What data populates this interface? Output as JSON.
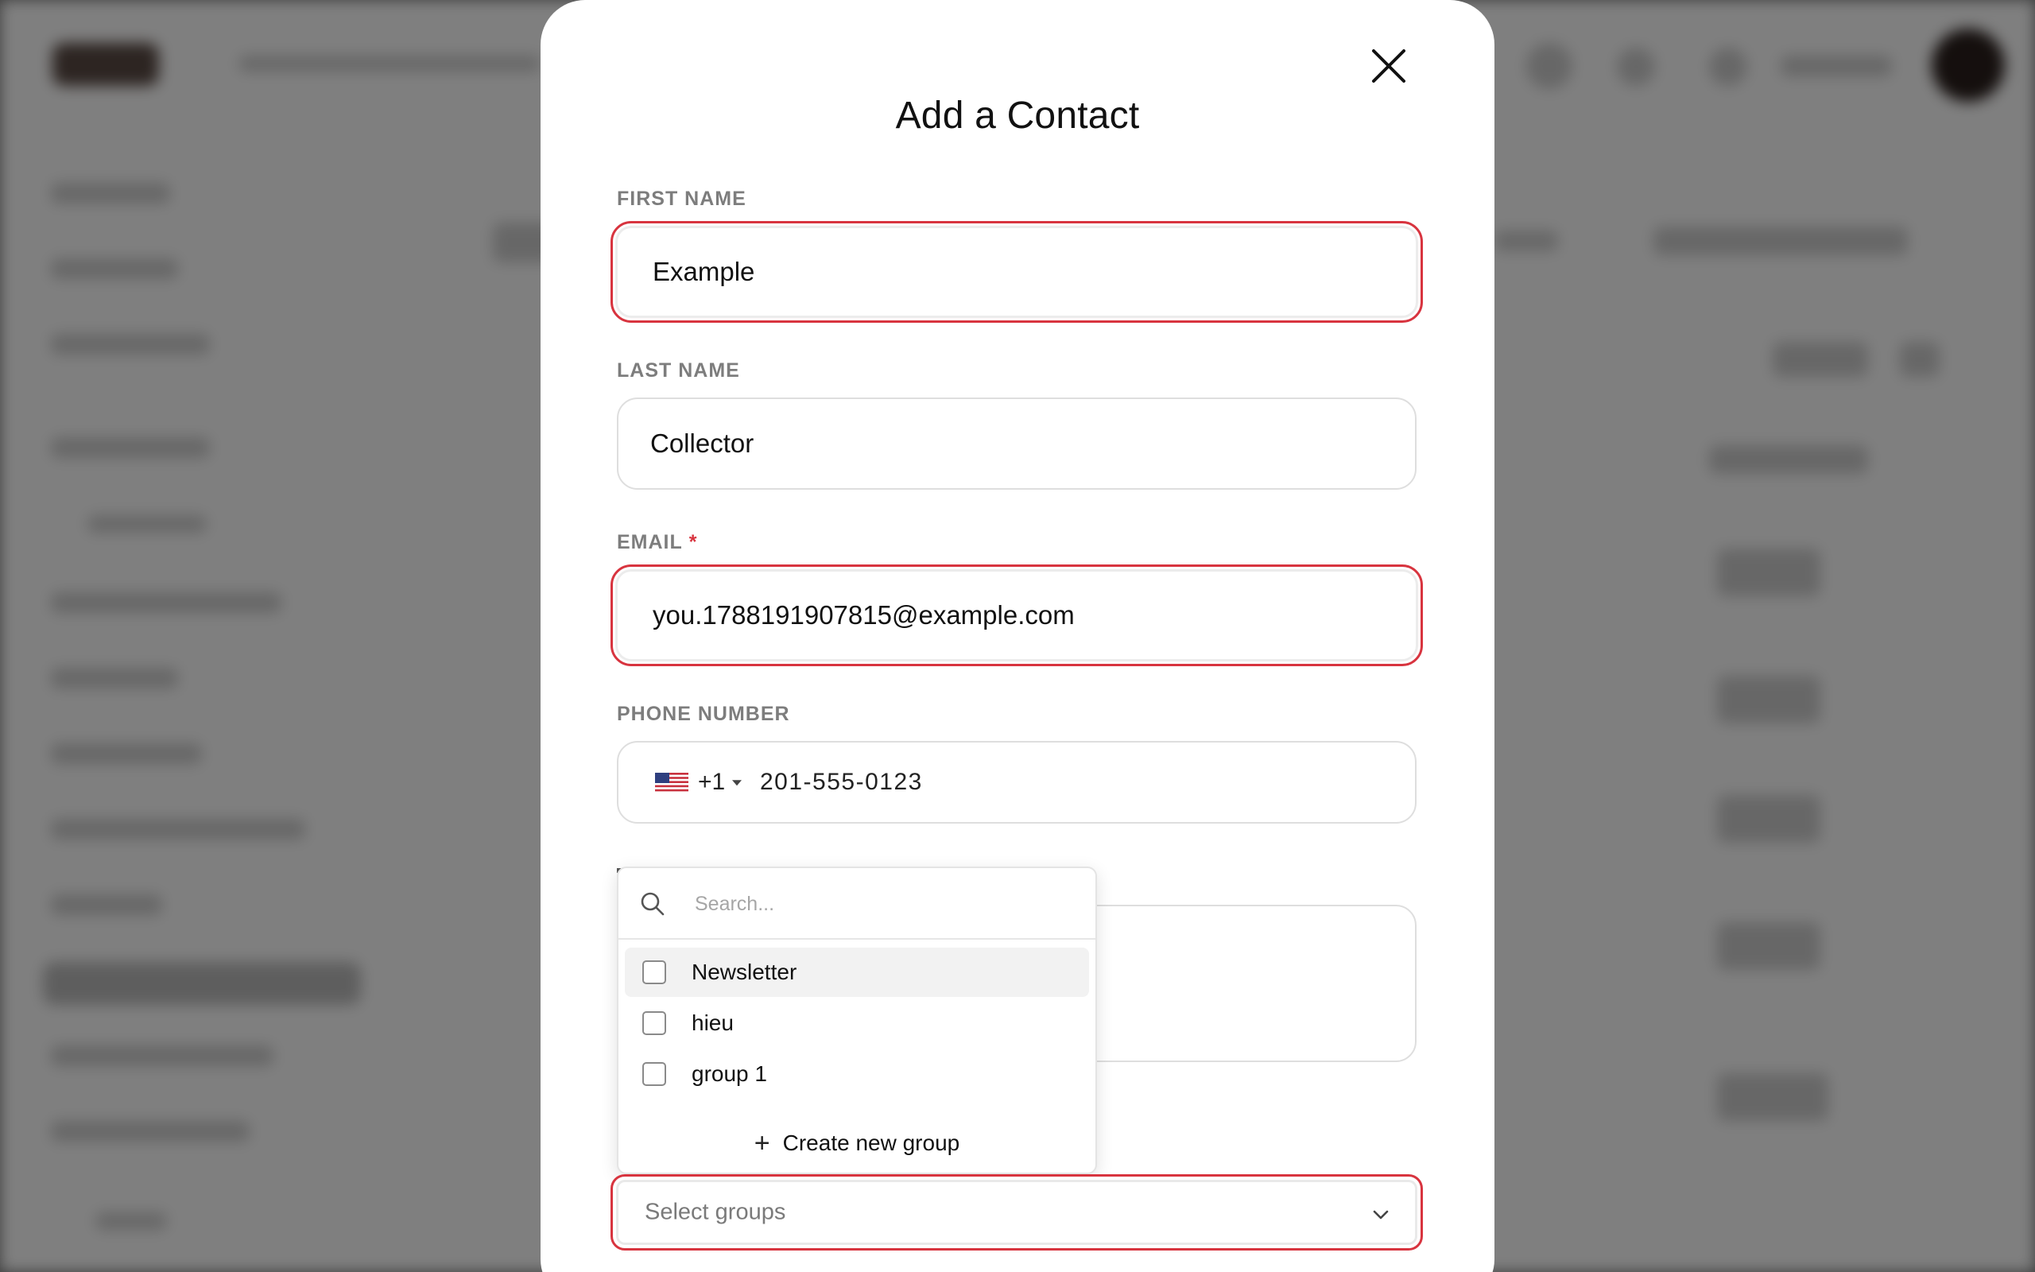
{
  "modal": {
    "title": "Add a Contact",
    "close_icon": "close-icon"
  },
  "form": {
    "first_name": {
      "label": "FIRST NAME",
      "value": "Example",
      "invalid": true
    },
    "last_name": {
      "label": "LAST NAME",
      "value": "Collector",
      "invalid": false
    },
    "email": {
      "label": "EMAIL",
      "required_mark": "*",
      "value": "you.1788191907815@example.com",
      "invalid": true
    },
    "phone": {
      "label": "PHONE NUMBER",
      "flag_icon": "us-flag-icon",
      "country_code": "+1",
      "number": "201-555-0123"
    }
  },
  "groups_dropdown": {
    "search_placeholder": "Search...",
    "options": [
      {
        "label": "Newsletter",
        "checked": false,
        "highlighted": true
      },
      {
        "label": "hieu",
        "checked": false,
        "highlighted": false
      },
      {
        "label": "group 1",
        "checked": false,
        "highlighted": false
      }
    ],
    "create_label": "Create new group",
    "select_placeholder": "Select groups"
  },
  "colors": {
    "error": "#d8343f",
    "label": "#7d7d7d",
    "text": "#111111"
  }
}
